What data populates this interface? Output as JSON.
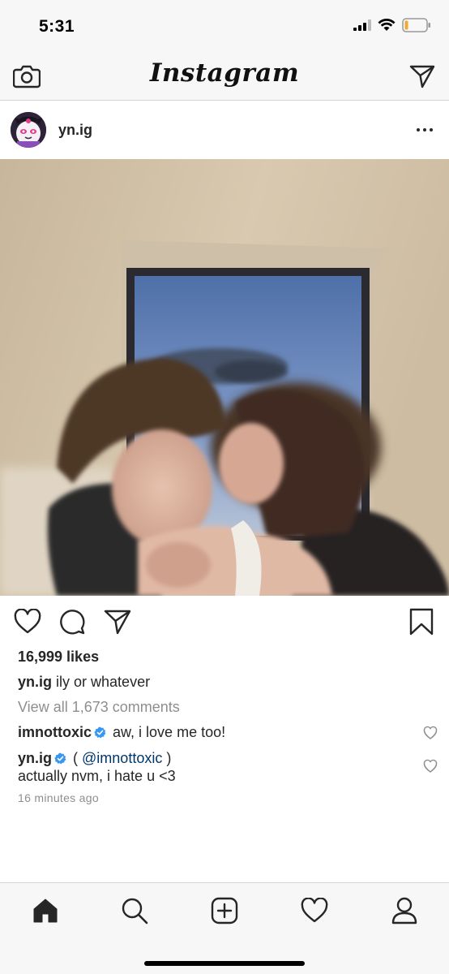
{
  "status_bar": {
    "time": "5:31",
    "icons": [
      "signal-icon",
      "wifi-icon",
      "battery-icon"
    ],
    "battery_color": "#f0a830"
  },
  "header": {
    "logo": "Instagram",
    "left_icon": "camera-icon",
    "right_icon": "direct-message-icon"
  },
  "post": {
    "username": "yn.ig",
    "avatar_icon": "avatar-image",
    "more_icon": "more-options-icon",
    "photo": "photo-of-couple-by-window",
    "actions": [
      "like-icon",
      "comment-icon",
      "share-icon",
      "save-icon"
    ],
    "likes": "16,999 likes",
    "caption_user": "yn.ig",
    "caption_text": "ily or whatever",
    "view_all": "View all 1,673 comments",
    "comments": [
      {
        "user": "imnottoxic",
        "verified": true,
        "text": "aw, i love me too!"
      },
      {
        "user": "yn.ig",
        "verified": true,
        "prefix": "( ",
        "mention": "@imnottoxic",
        "suffix": " )",
        "line2": "actually nvm, i hate u <3"
      }
    ],
    "timestamp": "16 minutes ago"
  },
  "tab_bar": {
    "tabs": [
      "home-icon",
      "search-icon",
      "new-post-icon",
      "activity-icon",
      "profile-icon"
    ],
    "active": "home-icon"
  },
  "colors": {
    "verified_blue": "#3897f0",
    "mention_blue": "#00376b",
    "muted_gray": "#8e8e8e",
    "text": "#262626"
  }
}
